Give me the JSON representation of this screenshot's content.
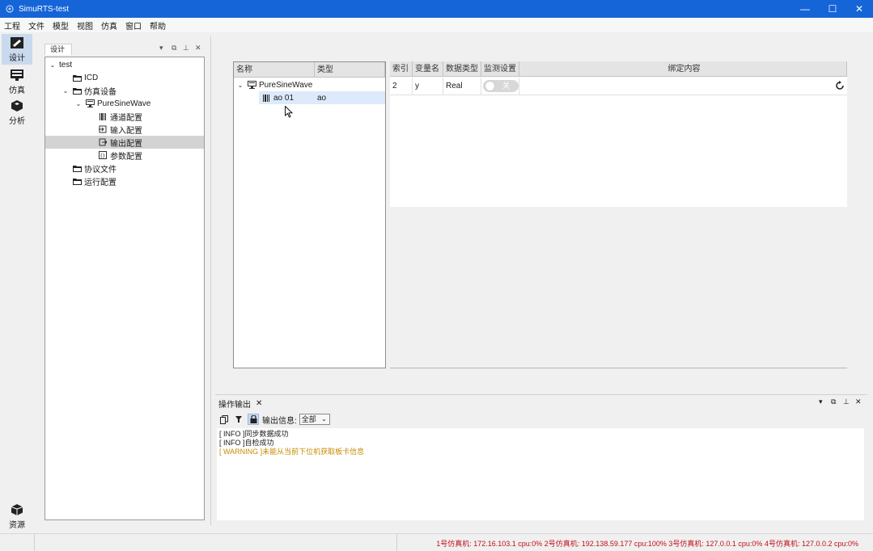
{
  "window": {
    "title": "SimuRTS-test",
    "minimize": "—",
    "maximize": "☐",
    "close": "✕"
  },
  "menu": [
    "工程",
    "文件",
    "模型",
    "视图",
    "仿真",
    "窗口",
    "帮助"
  ],
  "leftbar": {
    "items": [
      {
        "label": "设计"
      },
      {
        "label": "仿真"
      },
      {
        "label": "分析"
      }
    ],
    "bottom": {
      "label": "资源"
    }
  },
  "design_panel": {
    "tab": "设计",
    "tree": [
      {
        "label": "test"
      },
      {
        "label": "ICD"
      },
      {
        "label": "仿真设备"
      },
      {
        "label": "PureSineWave"
      },
      {
        "label": "通道配置"
      },
      {
        "label": "输入配置"
      },
      {
        "label": "输出配置"
      },
      {
        "label": "参数配置"
      },
      {
        "label": "协议文件"
      },
      {
        "label": "运行配置"
      }
    ]
  },
  "signal_tree": {
    "headers": [
      "名称",
      "类型"
    ],
    "rows": [
      {
        "name": "PureSineWave",
        "type": ""
      },
      {
        "name": "ao 01",
        "type": "ao"
      }
    ]
  },
  "bind_table": {
    "headers": [
      "索引",
      "变量名",
      "数据类型",
      "监测设置",
      "绑定内容"
    ],
    "row": {
      "index": "2",
      "var": "y",
      "dtype": "Real",
      "toggle": "关"
    }
  },
  "output": {
    "tab": "操作输出",
    "filter_label": "输出信息:",
    "filter_value": "全部",
    "logs": [
      {
        "text": "[ INFO ]同步数据成功",
        "color": "#1a1a1a"
      },
      {
        "text": "[ INFO ]自检成功",
        "color": "#1a1a1a"
      },
      {
        "text": "[ WARNING ]未能从当前下位机获取板卡信息",
        "color": "#c98a00"
      }
    ]
  },
  "status": "1号仿真机: 172.16.103.1 cpu:0% 2号仿真机: 192.138.59.177 cpu:100% 3号仿真机: 127.0.0.1 cpu:0% 4号仿真机: 127.0.0.2 cpu:0%"
}
